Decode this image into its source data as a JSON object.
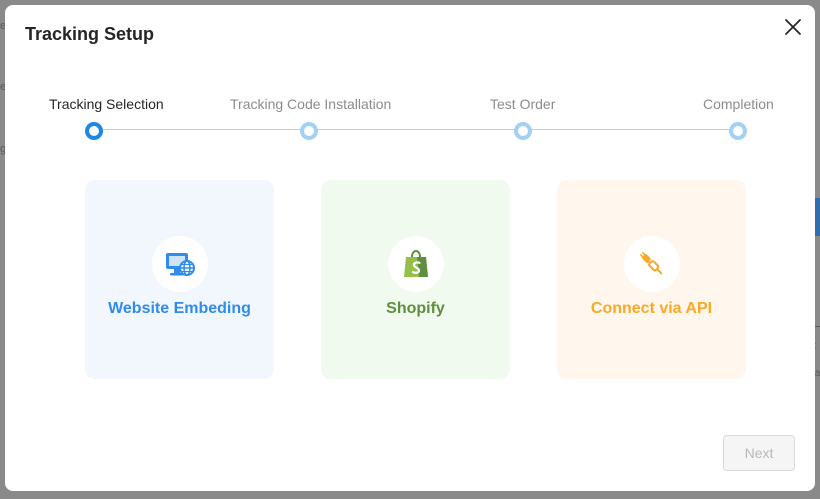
{
  "background": {
    "fragments": [
      "e",
      "e",
      "g",
      "t",
      "ta"
    ]
  },
  "modal": {
    "title": "Tracking Setup",
    "close_icon": "close-icon"
  },
  "stepper": {
    "current_step": 1,
    "steps": [
      {
        "label": "Tracking Selection",
        "active": true
      },
      {
        "label": "Tracking Code Installation",
        "active": false
      },
      {
        "label": "Test Order",
        "active": false
      },
      {
        "label": "Completion",
        "active": false
      }
    ],
    "colors": {
      "active_dot": "#1e88e5",
      "inactive_dot": "#a3d0f5",
      "line": "#b7d3ea"
    }
  },
  "options": [
    {
      "label": "Website Embeding",
      "icon": "monitor-globe-icon",
      "color": "#2f8ceb",
      "background": "#f2f7fe"
    },
    {
      "label": "Shopify",
      "icon": "shopify-bag-icon",
      "color": "#5e8e3e",
      "background": "#f0faee"
    },
    {
      "label": "Connect via API",
      "icon": "plug-connect-icon",
      "color": "#f7a928",
      "background": "#fff7ee"
    }
  ],
  "footer": {
    "next_label": "Next",
    "next_disabled": true
  }
}
